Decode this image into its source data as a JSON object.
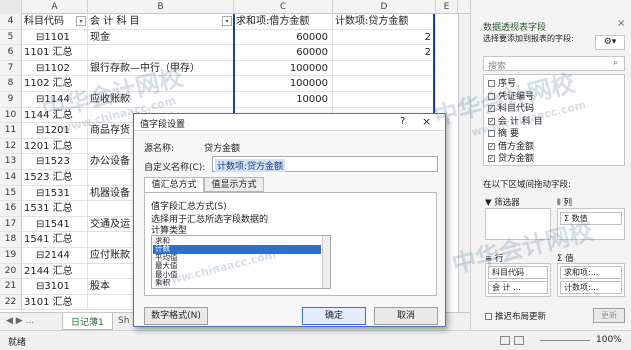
{
  "sheet": {
    "columns": [
      "A",
      "B",
      "C",
      "D",
      "E"
    ],
    "header_row": {
      "row": "4",
      "a": "科目代码",
      "b": "会 计 科 目",
      "c": "求和项:借方金额",
      "d": "计数项:贷方金额"
    },
    "rows": [
      {
        "row": "5",
        "a": "⊟1101",
        "b": "现金",
        "c": "60000",
        "d": "2"
      },
      {
        "row": "6",
        "a": "1101 汇总",
        "b": "",
        "c": "60000",
        "d": "2"
      },
      {
        "row": "7",
        "a": "⊟1102",
        "b": "银行存款—中行（甲存）",
        "c": "100000",
        "d": ""
      },
      {
        "row": "8",
        "a": "1102 汇总",
        "b": "",
        "c": "100000",
        "d": ""
      },
      {
        "row": "9",
        "a": "⊟1144",
        "b": "应收账款",
        "c": "10000",
        "d": ""
      },
      {
        "row": "10",
        "a": "1144 汇总",
        "b": "",
        "c": "",
        "d": ""
      },
      {
        "row": "11",
        "a": "⊟1201",
        "b": "商品存货",
        "c": "",
        "d": ""
      },
      {
        "row": "12",
        "a": "1201 汇总",
        "b": "",
        "c": "",
        "d": ""
      },
      {
        "row": "13",
        "a": "⊟1523",
        "b": "办公设备",
        "c": "",
        "d": ""
      },
      {
        "row": "14",
        "a": "1523 汇总",
        "b": "",
        "c": "",
        "d": ""
      },
      {
        "row": "15",
        "a": "⊟1531",
        "b": "机器设备",
        "c": "",
        "d": ""
      },
      {
        "row": "16",
        "a": "1531 汇总",
        "b": "",
        "c": "",
        "d": ""
      },
      {
        "row": "17",
        "a": "⊟1541",
        "b": "交通及运",
        "c": "",
        "d": ""
      },
      {
        "row": "18",
        "a": "1541 汇总",
        "b": "",
        "c": "",
        "d": ""
      },
      {
        "row": "19",
        "a": "⊟2144",
        "b": "应付账款",
        "c": "",
        "d": ""
      },
      {
        "row": "20",
        "a": "2144 汇总",
        "b": "",
        "c": "",
        "d": ""
      },
      {
        "row": "21",
        "a": "⊟3101",
        "b": "股本",
        "c": "",
        "d": ""
      },
      {
        "row": "22",
        "a": "3101 汇总",
        "b": "",
        "c": "",
        "d": ""
      }
    ],
    "tabs": {
      "nav": "◀  ▶  ...",
      "active": "日记薄1",
      "next": "Sh"
    }
  },
  "status": {
    "ready": "就绪",
    "zoom": "100%"
  },
  "pane": {
    "title": "数据透视表字段",
    "subtitle": "选择要添加到报表的字段:",
    "search_placeholder": "搜索",
    "fields": [
      {
        "label": "序号",
        "checked": false
      },
      {
        "label": "凭证编号",
        "checked": false
      },
      {
        "label": "科目代码",
        "checked": true
      },
      {
        "label": "会 计 科 目",
        "checked": true
      },
      {
        "label": "摘    要",
        "checked": false
      },
      {
        "label": "借方金额",
        "checked": true
      },
      {
        "label": "贷方金额",
        "checked": true
      }
    ],
    "drag_label": "在以下区域间拖动字段:",
    "filter_label": "筛选器",
    "columns_label": "列",
    "columns_item": "Σ 数值",
    "rows_label": "行",
    "values_label": "Σ 值",
    "rows_items": [
      "科目代码",
      "会 计 ..."
    ],
    "values_items": [
      "求和项:...",
      "计数项:..."
    ],
    "defer_label": "推迟布局更新",
    "update_button": "更新"
  },
  "dialog": {
    "title": "值字段设置",
    "source_label": "源名称:",
    "source_value": "贷方金额",
    "custom_label": "自定义名称(C):",
    "custom_value": "计数项:贷方金额",
    "tab_summarize": "值汇总方式",
    "tab_show": "值显示方式",
    "section_label": "值字段汇总方式(S)",
    "desc": "选择用于汇总所选字段数据的",
    "calc_type": "计算类型",
    "list_items": [
      "求和",
      "计数",
      "平均值",
      "最大值",
      "最小值",
      "乘积"
    ],
    "selected_index": 1,
    "number_format_button": "数字格式(N)",
    "ok_button": "确定",
    "cancel_button": "取消",
    "help_icon": "?",
    "close_icon": "×"
  },
  "watermarks": [
    "中华会计网校",
    "www.chinaacc.com"
  ]
}
